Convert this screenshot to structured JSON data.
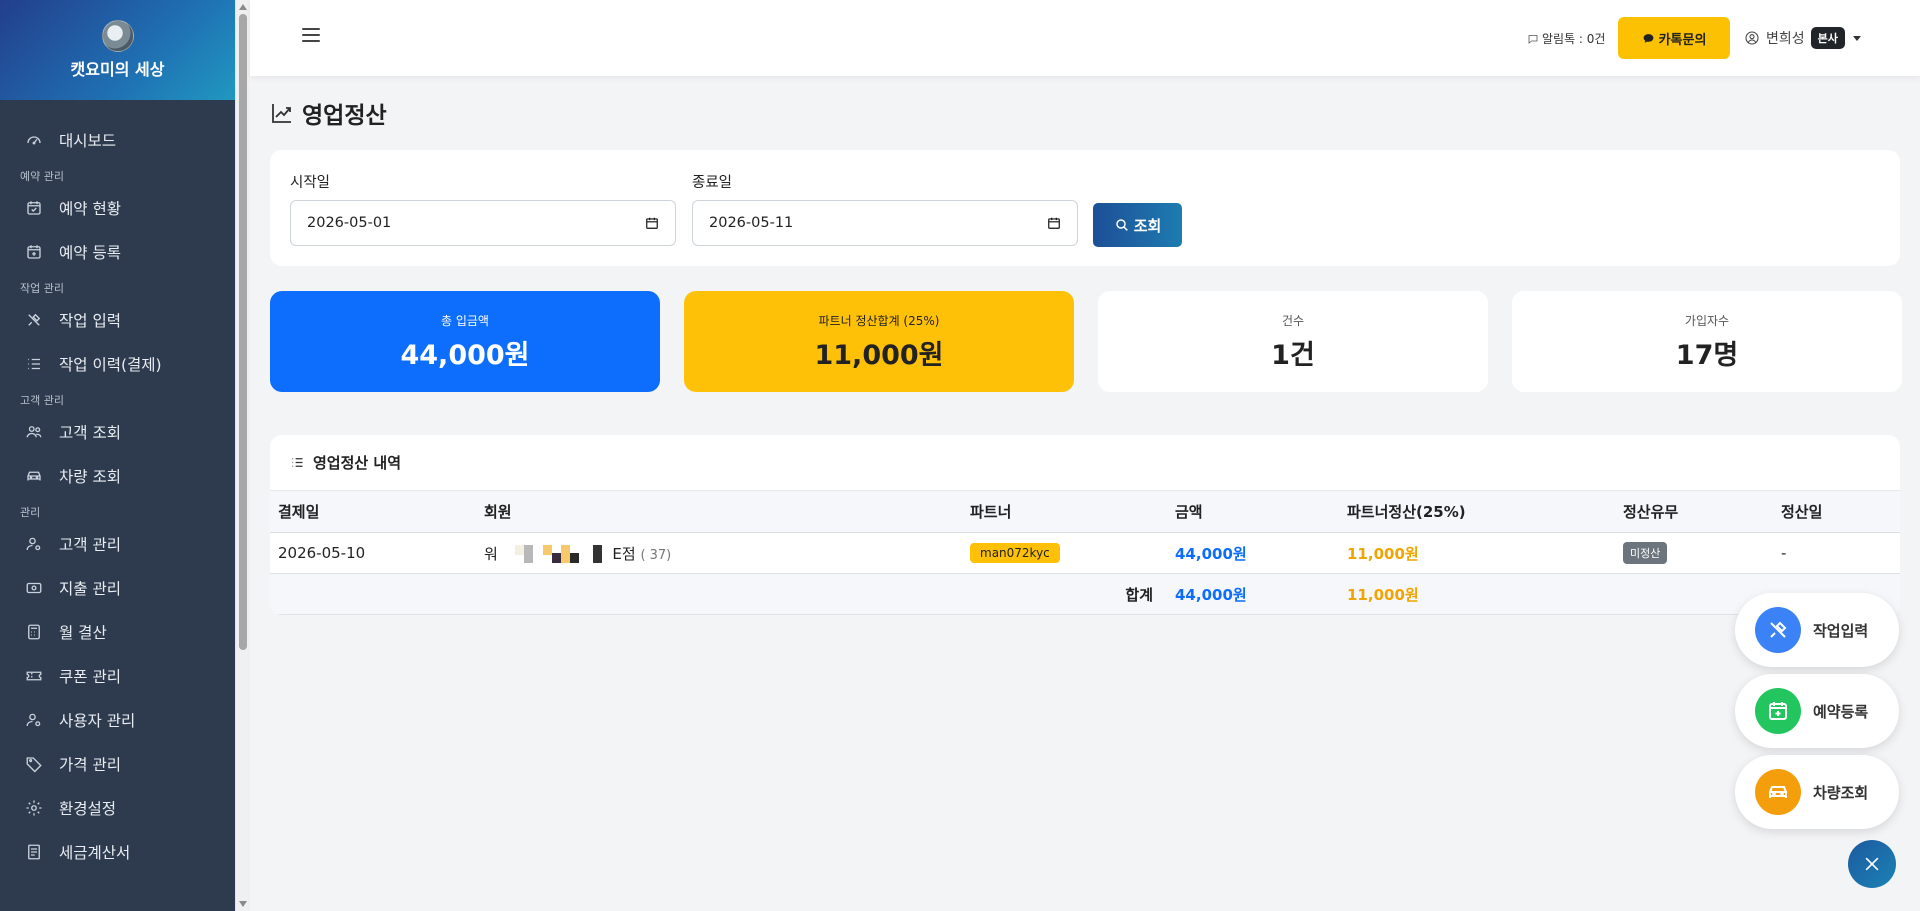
{
  "brand": {
    "name": "캣요미의 세상"
  },
  "sidebar": {
    "items": [
      {
        "label": "대시보드",
        "icon": "dashboard-icon"
      },
      {
        "section": "예약 관리"
      },
      {
        "label": "예약 현황",
        "icon": "calendar-check-icon"
      },
      {
        "label": "예약 등록",
        "icon": "calendar-plus-icon"
      },
      {
        "section": "작업 관리"
      },
      {
        "label": "작업 입력",
        "icon": "tools-icon"
      },
      {
        "label": "작업 이력(결제)",
        "icon": "list-icon"
      },
      {
        "section": "고객 관리"
      },
      {
        "label": "고객 조회",
        "icon": "people-icon"
      },
      {
        "label": "차량 조회",
        "icon": "car-icon"
      },
      {
        "section": "관리"
      },
      {
        "label": "고객 관리",
        "icon": "person-gear-icon"
      },
      {
        "label": "지출 관리",
        "icon": "cash-icon"
      },
      {
        "label": "월 결산",
        "icon": "calculator-icon"
      },
      {
        "label": "쿠폰 관리",
        "icon": "ticket-icon"
      },
      {
        "label": "사용자 관리",
        "icon": "person-gear-icon"
      },
      {
        "label": "가격 관리",
        "icon": "tag-icon"
      },
      {
        "label": "환경설정",
        "icon": "gear-icon"
      },
      {
        "label": "세금계산서",
        "icon": "receipt-icon"
      }
    ]
  },
  "header": {
    "alarm_text": "알림톡 : 0건",
    "kakao_label": "카톡문의",
    "user_name": "변희성",
    "user_badge": "본사"
  },
  "page": {
    "title": "영업정산"
  },
  "filter": {
    "start_label": "시작일",
    "start_value": "2026-05-01",
    "end_label": "종료일",
    "end_value": "2026-05-11",
    "search_label": "조회"
  },
  "stats": {
    "total_label": "총 입금액",
    "total_value": "44,000원",
    "partner_label": "파트너 정산합계 (25%)",
    "partner_value": "11,000원",
    "count_label": "건수",
    "count_value": "1건",
    "members_label": "가입자수",
    "members_value": "17명"
  },
  "table": {
    "title": "영업정산 내역",
    "headers": [
      "결제일",
      "회원",
      "파트너",
      "금액",
      "파트너정산(25%)",
      "정산유무",
      "정산일"
    ],
    "rows": [
      {
        "date": "2026-05-10",
        "member_prefix": "워",
        "member_suffix": "E점",
        "member_tail": "( 37)",
        "partner": "man072kyc",
        "amount": "44,000원",
        "partner_amount": "11,000원",
        "status": "미정산",
        "settle_date": "-"
      }
    ],
    "total_label": "합계",
    "total_amount": "44,000원",
    "total_partner_amount": "11,000원"
  },
  "fabs": [
    {
      "label": "작업입력",
      "icon": "tools-icon",
      "color": "#3b82f6"
    },
    {
      "label": "예약등록",
      "icon": "calendar-plus-icon",
      "color": "#22c55e"
    },
    {
      "label": "차량조회",
      "icon": "car-icon",
      "color": "#f59e0b"
    }
  ],
  "colors": {
    "primary": "#0d6efd",
    "warning": "#ffc107",
    "sidebar": "#2e3b4e"
  }
}
